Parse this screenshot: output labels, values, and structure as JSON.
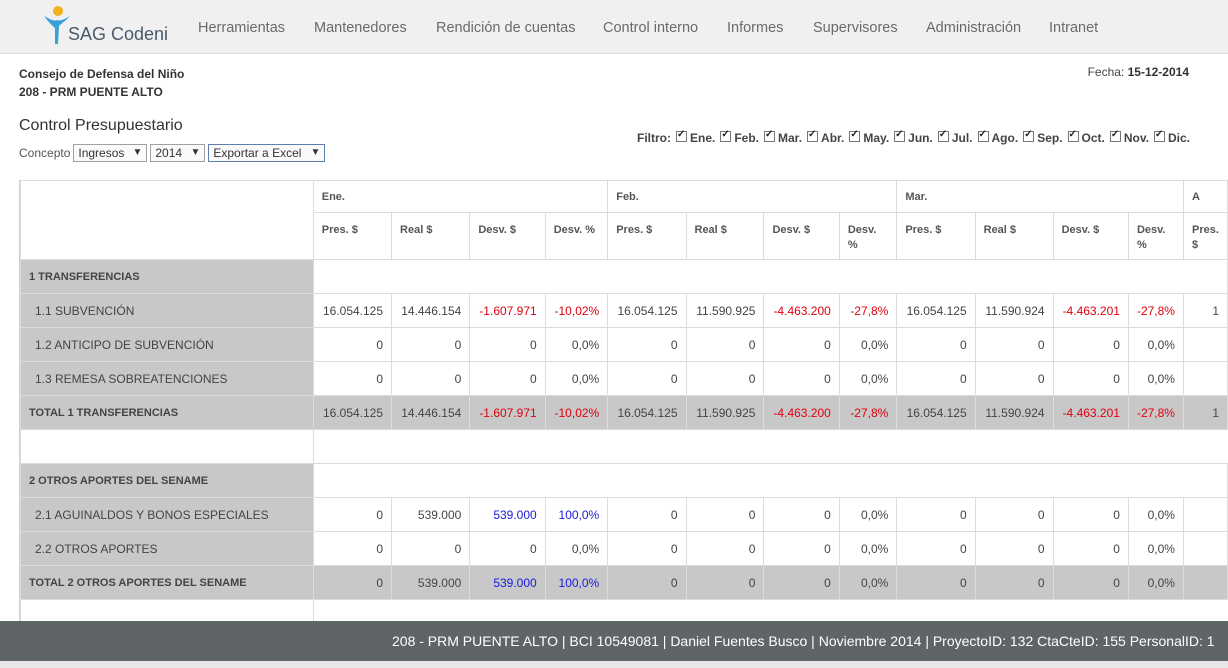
{
  "app": {
    "name": "SAG Codeni"
  },
  "nav": [
    "Herramientas",
    "Mantenedores",
    "Rendición de cuentas",
    "Control interno",
    "Informes",
    "Supervisores",
    "Administración",
    "Intranet"
  ],
  "org": {
    "name": "Consejo de Defensa del Niño",
    "project": "208 - PRM PUENTE ALTO"
  },
  "fecha": {
    "label": "Fecha:",
    "value": "15-12-2014"
  },
  "title": "Control Presupuestario",
  "concepto": {
    "label": "Concepto",
    "tipo": "Ingresos",
    "anio": "2014",
    "export": "Exportar a Excel"
  },
  "filtro": {
    "label": "Filtro:",
    "months": [
      "Ene.",
      "Feb.",
      "Mar.",
      "Abr.",
      "May.",
      "Jun.",
      "Jul.",
      "Ago.",
      "Sep.",
      "Oct.",
      "Nov.",
      "Dic."
    ]
  },
  "table": {
    "months": [
      "Ene.",
      "Feb.",
      "Mar.",
      "A"
    ],
    "subcols": [
      "Pres. $",
      "Real $",
      "Desv. $",
      "Desv. %"
    ],
    "rows": [
      {
        "type": "section",
        "label": "1 TRANSFERENCIAS"
      },
      {
        "type": "item",
        "label": "1.1 SUBVENCIÓN",
        "values": [
          "16.054.125",
          "14.446.154",
          "-1.607.971",
          "-10,02%",
          "16.054.125",
          "11.590.925",
          "-4.463.200",
          "-27,8%",
          "16.054.125",
          "11.590.924",
          "-4.463.201",
          "-27,8%",
          "1"
        ]
      },
      {
        "type": "item",
        "label": "1.2 ANTICIPO DE SUBVENCIÓN",
        "values": [
          "0",
          "0",
          "0",
          "0,0%",
          "0",
          "0",
          "0",
          "0,0%",
          "0",
          "0",
          "0",
          "0,0%",
          ""
        ]
      },
      {
        "type": "item",
        "label": "1.3 REMESA SOBREATENCIONES",
        "values": [
          "0",
          "0",
          "0",
          "0,0%",
          "0",
          "0",
          "0",
          "0,0%",
          "0",
          "0",
          "0",
          "0,0%",
          ""
        ]
      },
      {
        "type": "total",
        "label": "TOTAL 1 TRANSFERENCIAS",
        "values": [
          "16.054.125",
          "14.446.154",
          "-1.607.971",
          "-10,02%",
          "16.054.125",
          "11.590.925",
          "-4.463.200",
          "-27,8%",
          "16.054.125",
          "11.590.924",
          "-4.463.201",
          "-27,8%",
          "1"
        ]
      },
      {
        "type": "spacer"
      },
      {
        "type": "section",
        "label": "2 OTROS APORTES DEL SENAME"
      },
      {
        "type": "item",
        "label": "2.1 AGUINALDOS Y BONOS ESPECIALES",
        "values": [
          "0",
          "539.000",
          "539.000",
          "100,0%",
          "0",
          "0",
          "0",
          "0,0%",
          "0",
          "0",
          "0",
          "0,0%",
          ""
        ]
      },
      {
        "type": "item",
        "label": "2.2 OTROS APORTES",
        "values": [
          "0",
          "0",
          "0",
          "0,0%",
          "0",
          "0",
          "0",
          "0,0%",
          "0",
          "0",
          "0",
          "0,0%",
          ""
        ]
      },
      {
        "type": "total",
        "label": "TOTAL 2 OTROS APORTES DEL SENAME",
        "values": [
          "0",
          "539.000",
          "539.000",
          "100,0%",
          "0",
          "0",
          "0",
          "0,0%",
          "0",
          "0",
          "0",
          "0,0%",
          ""
        ]
      },
      {
        "type": "spacer"
      }
    ]
  },
  "footer": "208 - PRM PUENTE ALTO | BCI 10549081 | Daniel Fuentes Busco | Noviembre 2014 | ProyectoID: 132 CtaCteID: 155 PersonalID: 1",
  "colors": {
    "negative": "#e0000f",
    "positive": "#1a1ae0",
    "header_bg": "#f0f0f0",
    "footer_bg": "#5f6466",
    "label_bg": "#c8c8c8"
  }
}
